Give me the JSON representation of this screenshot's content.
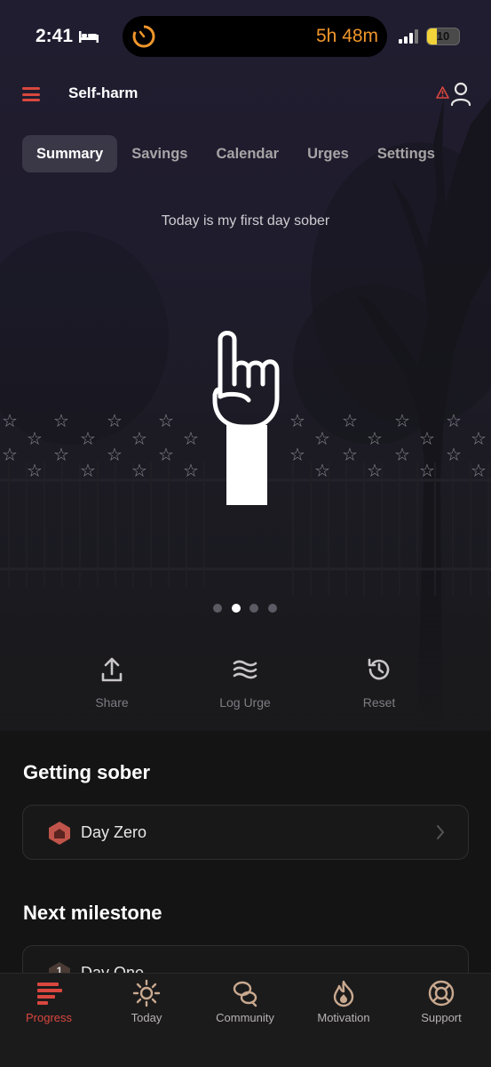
{
  "status_bar": {
    "time": "2:41",
    "live_activity_time": "5h 48m",
    "battery": "10"
  },
  "header": {
    "title": "Self-harm"
  },
  "tabs": [
    {
      "label": "Summary",
      "active": true
    },
    {
      "label": "Savings",
      "active": false
    },
    {
      "label": "Calendar",
      "active": false
    },
    {
      "label": "Urges",
      "active": false
    },
    {
      "label": "Settings",
      "active": false
    }
  ],
  "summary": {
    "headline": "Today is my first day sober",
    "pages": 4,
    "current_page": 1
  },
  "actions": [
    {
      "label": "Share",
      "icon": "share-icon"
    },
    {
      "label": "Log Urge",
      "icon": "waves-icon"
    },
    {
      "label": "Reset",
      "icon": "history-icon"
    }
  ],
  "getting_sober": {
    "title": "Getting sober",
    "item": "Day Zero"
  },
  "next_milestone": {
    "title": "Next milestone",
    "item": "Day One",
    "badge": "1"
  },
  "tabbar": [
    {
      "label": "Progress",
      "icon": "progress-icon",
      "active": true
    },
    {
      "label": "Today",
      "icon": "sun-icon",
      "active": false
    },
    {
      "label": "Community",
      "icon": "community-icon",
      "active": false
    },
    {
      "label": "Motivation",
      "icon": "flame-icon",
      "active": false
    },
    {
      "label": "Support",
      "icon": "lifebuoy-icon",
      "active": false
    }
  ],
  "colors": {
    "accent": "#d9473e",
    "timer": "#f0962a",
    "background": "#141414"
  }
}
